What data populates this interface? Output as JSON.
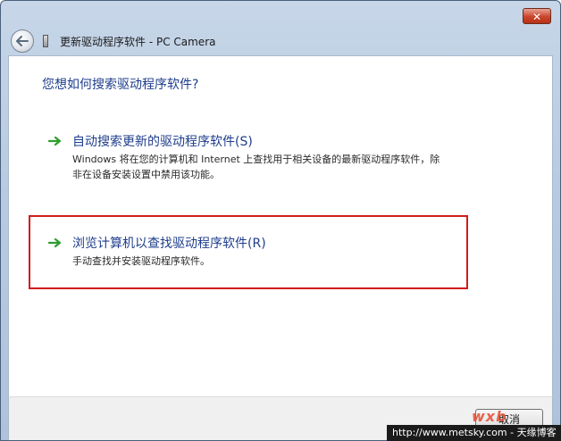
{
  "window": {
    "title": "更新驱动程序软件 - PC Camera",
    "close_label": "✕"
  },
  "main": {
    "heading": "您想如何搜索驱动程序软件?",
    "options": [
      {
        "title": "自动搜索更新的驱动程序软件(S)",
        "description": "Windows 将在您的计算机和 Internet 上查找用于相关设备的最新驱动程序软件，除非在设备安装设置中禁用该功能。"
      },
      {
        "title": "浏览计算机以查找驱动程序软件(R)",
        "description": "手动查找并安装驱动程序软件。"
      }
    ]
  },
  "footer": {
    "cancel_label": "取消"
  },
  "watermark": {
    "logo_text": "wxb",
    "url_text": "http://www.metsky.com - 天缘博客"
  },
  "colors": {
    "link_blue": "#1e3d8c",
    "arrow_green": "#2f9e2f",
    "highlight_red": "#d21c1c"
  }
}
